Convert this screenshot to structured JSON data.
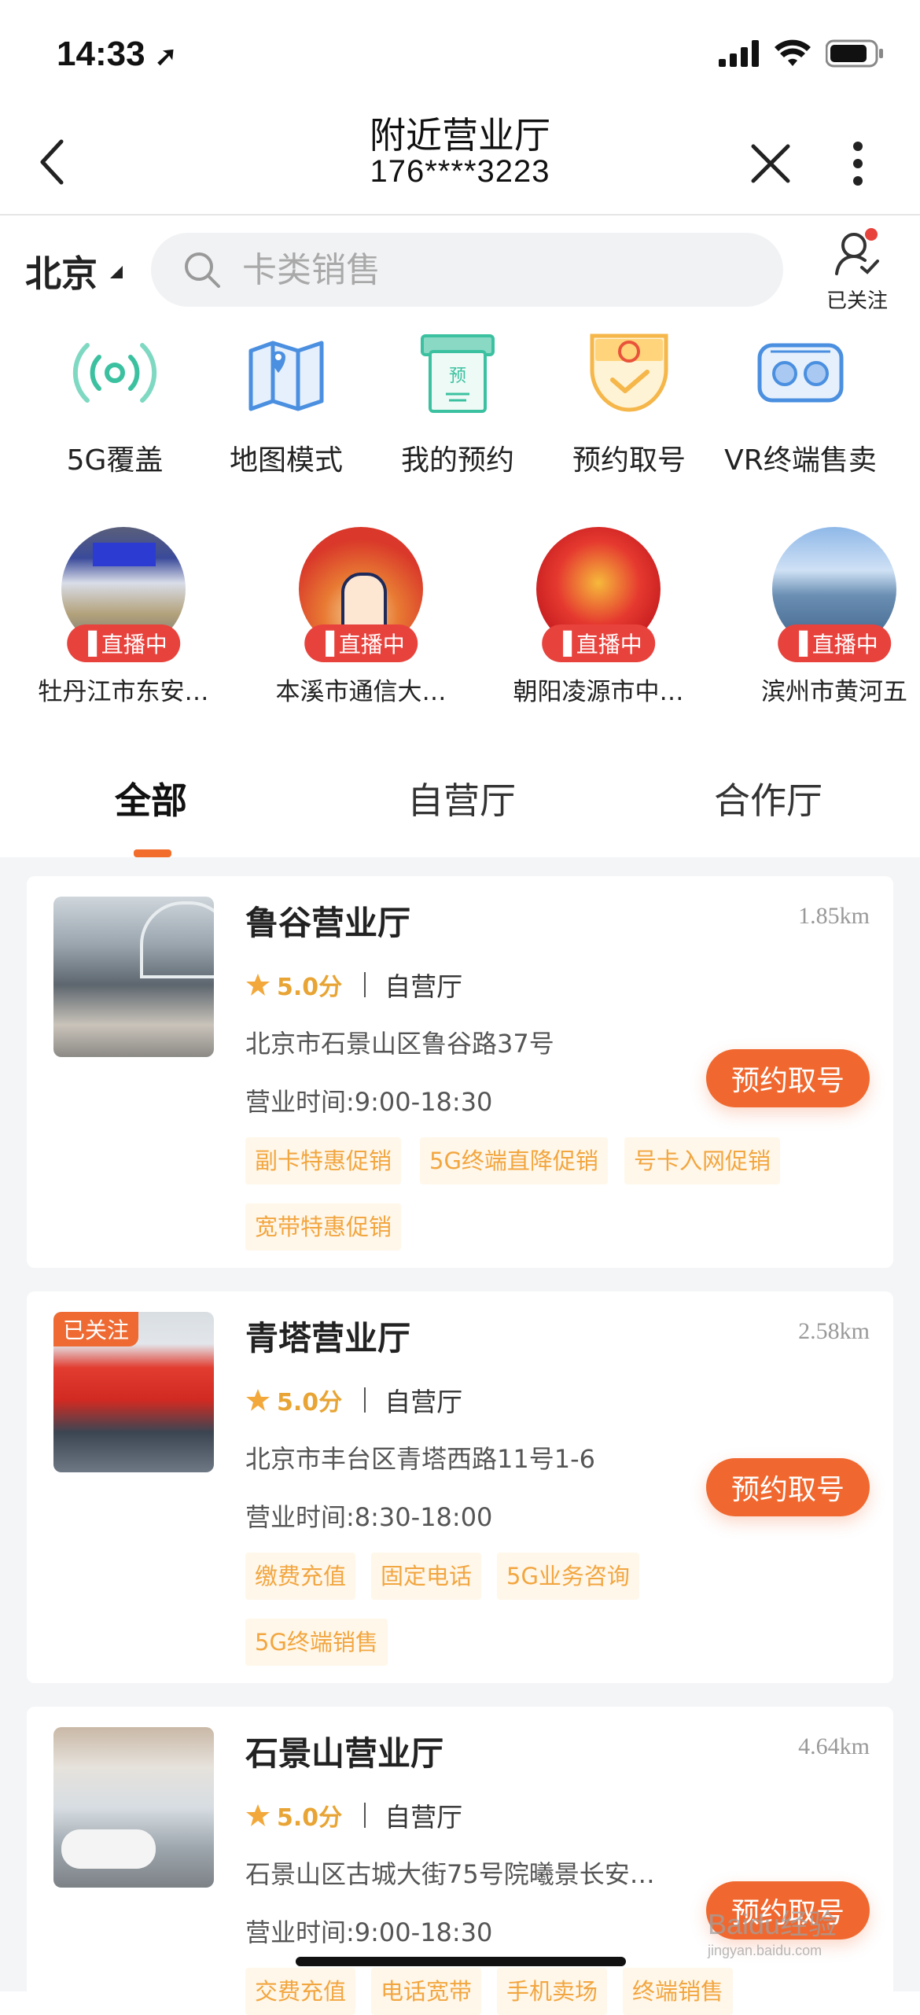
{
  "status_bar": {
    "time": "14:33"
  },
  "nav": {
    "title": "附近营业厅",
    "subtitle": "176****3223"
  },
  "search": {
    "city": "北京",
    "placeholder": "卡类销售",
    "follow_label": "已关注"
  },
  "quick_links": [
    {
      "label": "5G覆盖",
      "icon": "signal-tower-icon"
    },
    {
      "label": "地图模式",
      "icon": "map-icon"
    },
    {
      "label": "我的预约",
      "icon": "reservation-icon"
    },
    {
      "label": "预约取号",
      "icon": "ticket-icon"
    },
    {
      "label": "VR终端售卖",
      "icon": "vr-goggles-icon"
    }
  ],
  "live": {
    "badge": "直播中",
    "items": [
      {
        "name": "牡丹江市东安…"
      },
      {
        "name": "本溪市通信大…"
      },
      {
        "name": "朝阳凌源市中…"
      },
      {
        "name": "滨州市黄河五"
      }
    ]
  },
  "tabs": [
    {
      "label": "全部",
      "active": true
    },
    {
      "label": "自营厅",
      "active": false
    },
    {
      "label": "合作厅",
      "active": false
    }
  ],
  "stores": [
    {
      "name": "鲁谷营业厅",
      "distance": "1.85km",
      "rating": "5.0分",
      "type": "自营厅",
      "address": "北京市石景山区鲁谷路37号",
      "hours": "营业时间:9:00-18:30",
      "button": "预约取号",
      "tags": [
        "副卡特惠促销",
        "5G终端直降促销",
        "号卡入网促销",
        "宽带特惠促销"
      ]
    },
    {
      "name": "青塔营业厅",
      "distance": "2.58km",
      "rating": "5.0分",
      "type": "自营厅",
      "address": "北京市丰台区青塔西路11号1-6",
      "hours": "营业时间:8:30-18:00",
      "button": "预约取号",
      "followed_badge": "已关注",
      "tags": [
        "缴费充值",
        "固定电话",
        "5G业务咨询",
        "5G终端销售"
      ]
    },
    {
      "name": "石景山营业厅",
      "distance": "4.64km",
      "rating": "5.0分",
      "type": "自营厅",
      "address": "石景山区古城大街75号院曦景长安…",
      "hours": "营业时间:9:00-18:30",
      "button": "预约取号",
      "tags": [
        "交费充值",
        "电话宽带",
        "手机卖场",
        "终端销售"
      ]
    }
  ],
  "watermark": "Baidu经验",
  "watermark_sub": "jingyan.baidu.com",
  "colors": {
    "accent": "#f0682f",
    "live_red": "#e8423d",
    "tag_text": "#f2a640",
    "tag_bg": "#fff7ea",
    "icon_teal": "#3cc1a0",
    "icon_blue": "#4a8fe0"
  }
}
